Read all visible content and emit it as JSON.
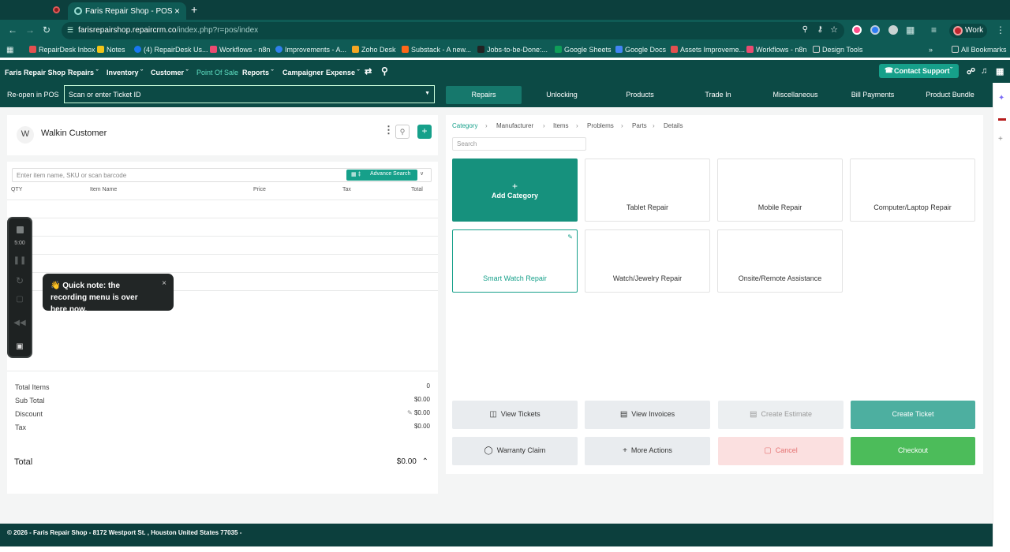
{
  "browser": {
    "tab_title": "Faris Repair Shop - POS",
    "tab_close": "×",
    "new_tab": "+",
    "url_host": "farisrepairshop.repaircrm.co",
    "url_path": "/index.php?r=pos/index",
    "profile": "Work"
  },
  "bookmarks": [
    {
      "label": "RepairDesk Inbox",
      "color": "#e35050"
    },
    {
      "label": "Notes",
      "color": "#f0c419"
    },
    {
      "label": "(4) RepairDesk Us...",
      "color": "#1877f2"
    },
    {
      "label": "Workflows - n8n",
      "color": "#ea4b71"
    },
    {
      "label": "Improvements - A...",
      "color": "#2f80ed"
    },
    {
      "label": "Zoho Desk",
      "color": "#f5a623"
    },
    {
      "label": "Substack - A new...",
      "color": "#ff6719"
    },
    {
      "label": "Jobs-to-be-Done:...",
      "color": "#222222"
    },
    {
      "label": "Google Sheets",
      "color": "#0f9d58"
    },
    {
      "label": "Google Docs",
      "color": "#4285f4"
    },
    {
      "label": "Assets Improveme...",
      "color": "#e35050"
    },
    {
      "label": "Workflows - n8n",
      "color": "#ea4b71"
    },
    {
      "label": "Design Tools",
      "color": "#cccccc"
    }
  ],
  "bookmarks_more": "»",
  "all_bookmarks": "All Bookmarks",
  "nav": {
    "items": [
      "Faris Repair Shop",
      "Repairs",
      "Inventory",
      "Customer",
      "Point Of Sale",
      "Reports",
      "Campaigner",
      "Expense"
    ],
    "contact_support": "Contact Support"
  },
  "subnav": {
    "reopen": "Re-open in POS",
    "ticket_placeholder": "Scan or enter Ticket ID",
    "tabs": [
      "Repairs",
      "Unlocking",
      "Products",
      "Trade In",
      "Miscellaneous",
      "Bill Payments",
      "Product Bundle"
    ]
  },
  "customer": {
    "initial": "W",
    "name": "Walkin Customer"
  },
  "items": {
    "search_placeholder": "Enter item name, SKU or scan barcode",
    "advance_search": "Advance Search",
    "columns": [
      "QTY",
      "Item Name",
      "Price",
      "Tax",
      "Total"
    ]
  },
  "totals": {
    "rows": [
      {
        "label": "Total Items",
        "value": "0"
      },
      {
        "label": "Sub Total",
        "value": "$0.00"
      },
      {
        "label": "Discount",
        "value": "$0.00"
      },
      {
        "label": "Tax",
        "value": "$0.00"
      }
    ],
    "total_label": "Total",
    "total_value": "$0.00"
  },
  "recorder": {
    "time": "5:00",
    "tooltip": "👋 Quick note: the recording menu is over here now.",
    "tooltip_close": "×"
  },
  "catalog": {
    "breadcrumb": [
      "Category",
      "Manufacturer",
      "Items",
      "Problems",
      "Parts",
      "Details"
    ],
    "search_placeholder": "Search",
    "add_category": "Add Category",
    "tiles": [
      "Tablet Repair",
      "Mobile Repair",
      "Computer/Laptop Repair",
      "Smart Watch Repair",
      "Watch/Jewelry Repair",
      "Onsite/Remote Assistance"
    ]
  },
  "actions": {
    "view_tickets": "View Tickets",
    "view_invoices": "View Invoices",
    "create_estimate": "Create Estimate",
    "create_ticket": "Create Ticket",
    "warranty_claim": "Warranty Claim",
    "more_actions": "More Actions",
    "cancel": "Cancel",
    "checkout": "Checkout"
  },
  "footer": "© 2026 - Faris Repair Shop - 8172 Westport St. , Houston United States 77035 -"
}
